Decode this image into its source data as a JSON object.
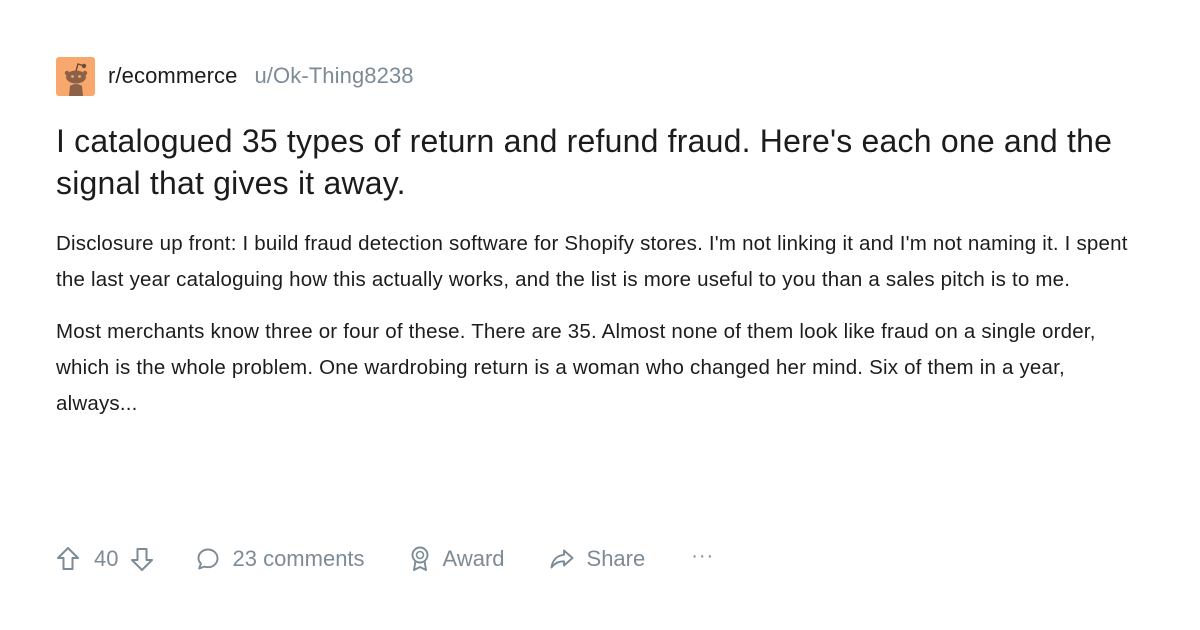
{
  "post": {
    "subreddit": "r/ecommerce",
    "username": "u/Ok-Thing8238",
    "title": "I catalogued 35 types of return and refund fraud. Here's each one and the signal that gives it away.",
    "paragraphs": [
      "Disclosure up front: I build fraud detection software for Shopify stores. I'm not linking it and I'm not naming it. I spent the last year cataloguing how this actually works, and the list is more useful to you than a sales pitch is to me.",
      "Most merchants know three or four of these. There are 35. Almost none of them look like fraud on a single order, which is the whole problem. One wardrobing return is a woman who changed her mind. Six of them in a year, always..."
    ]
  },
  "actions": {
    "vote_count": "40",
    "comments_label": "23 comments",
    "award_label": "Award",
    "share_label": "Share",
    "more_label": "···"
  },
  "icons": {
    "upvote": "arrow-up-outline",
    "downvote": "arrow-down-outline",
    "comment": "speech-bubble-outline",
    "award": "award-ribbon-outline",
    "share": "share-arrow-outline",
    "avatar": "reddit-snoo"
  },
  "colors": {
    "avatar_bg": "#f8a86d",
    "text_primary": "#1c1c1c",
    "text_muted": "#7c8b96"
  }
}
